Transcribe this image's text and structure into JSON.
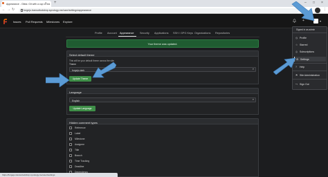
{
  "browser": {
    "tab_title": "Appearance - Gitea: Git with a cup of tea",
    "tab_close": "×",
    "new_tab": "+",
    "url": "forgejo.transuttodsbnp.synology.me/user/settings/appearance",
    "win_min": "–",
    "win_max": "□",
    "win_close": "×",
    "back": "←",
    "forward": "→",
    "reload": "↻",
    "star": "☆",
    "menu_dots": "⋮"
  },
  "nav": {
    "links": [
      "Issues",
      "Pull Requests",
      "Milestones",
      "Explore"
    ],
    "bell": "🔔",
    "plus": "+",
    "caret": "▾"
  },
  "settings_tabs": [
    "Profile",
    "Account",
    "Appearance",
    "Security",
    "Applications",
    "SSH / GPG Keys",
    "Organizations",
    "Repositories"
  ],
  "flash": "Your theme was updated.",
  "theme": {
    "header": "Select default theme",
    "help": "This will be your default theme across the site.",
    "label": "Theme",
    "value": "forgejo-dark",
    "caret": "▾",
    "button": "Update Theme"
  },
  "language": {
    "header": "Language",
    "value": "English",
    "caret": "▾",
    "button": "Update Language"
  },
  "hidden": {
    "header": "Hidden comment types",
    "items": [
      "Reference",
      "Label",
      "Milestone",
      "Assignee",
      "Title",
      "Branch",
      "Time Tracking",
      "Deadline",
      "Dependency"
    ]
  },
  "menu": {
    "signed_in": "Signed in as admin",
    "items": [
      {
        "icon": "◷",
        "label": "Profile"
      },
      {
        "icon": "☆",
        "label": "Starred"
      },
      {
        "icon": "◎",
        "label": "Subscriptions"
      },
      {
        "icon": "⚙",
        "label": "Settings"
      },
      {
        "icon": "?",
        "label": "Help"
      },
      {
        "icon": "⚑",
        "label": "Site Administration"
      },
      {
        "icon": "↪",
        "label": "Sign Out"
      }
    ]
  },
  "status_url": "https://forgejo.transuttodsbnp.synology.me/user/settings",
  "colors": {
    "background": "#1c1d1f",
    "accent_green": "#3f8f48",
    "flash_green": "#1f5c31",
    "arrow_blue": "#5b9bd5"
  }
}
